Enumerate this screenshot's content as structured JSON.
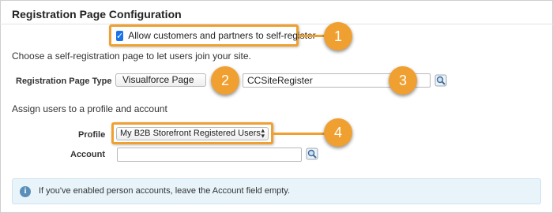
{
  "section": {
    "title": "Registration Page Configuration"
  },
  "self_register": {
    "checked": true,
    "label": "Allow customers and partners to self-register"
  },
  "choose_text": "Choose a self-registration page to let users join your site.",
  "registration_page": {
    "label": "Registration Page Type",
    "type_value": "Visualforce Page",
    "page_value": "CCSiteRegister"
  },
  "assign_text": "Assign users to a profile and account",
  "profile": {
    "label": "Profile",
    "value": "My B2B Storefront Registered Users"
  },
  "account": {
    "label": "Account",
    "value": ""
  },
  "info": {
    "text": "If you've enabled person accounts, leave the Account field empty."
  },
  "callouts": [
    "1",
    "2",
    "3",
    "4"
  ],
  "colors": {
    "callout": "#f0a030",
    "checkbox": "#1a73e8",
    "info_bg": "#e8f4fa"
  },
  "icons": {
    "lookup": "magnifier-lookup-icon",
    "info": "info-icon"
  }
}
